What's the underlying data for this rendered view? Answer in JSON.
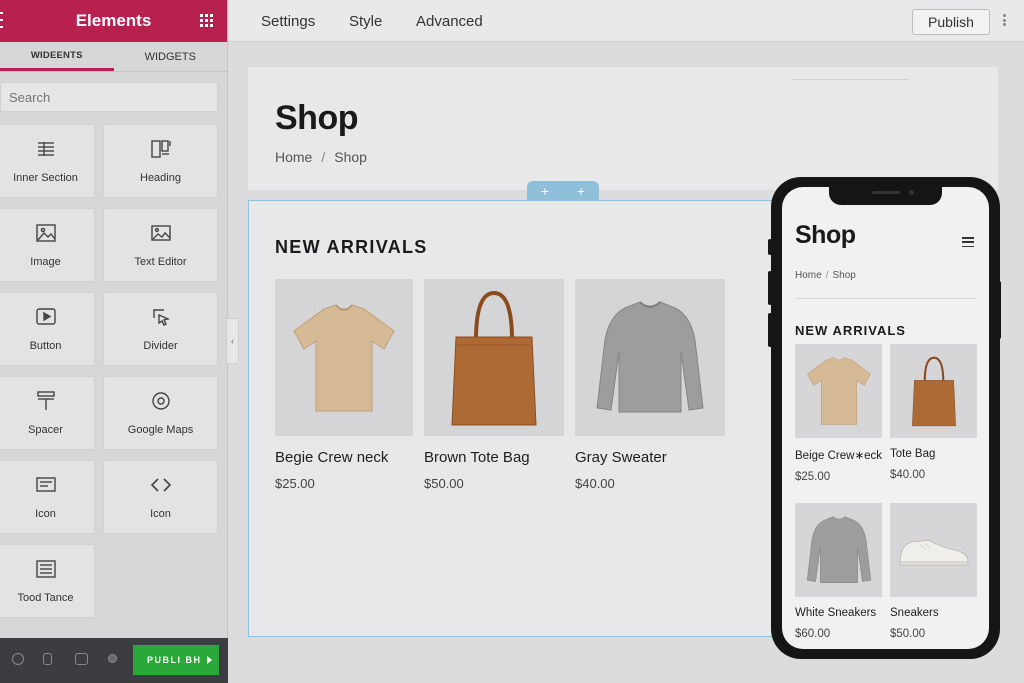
{
  "panel": {
    "title": "Elements",
    "tabs": [
      "WIDEENTS",
      "WIDGETS"
    ],
    "search_placeholder": "Search",
    "widgets": [
      {
        "label": "Inner Section",
        "icon": "inner-section-icon"
      },
      {
        "label": "Heading",
        "icon": "heading-icon"
      },
      {
        "label": "Image",
        "icon": "image-icon"
      },
      {
        "label": "Text Editor",
        "icon": "text-editor-icon"
      },
      {
        "label": "Button",
        "icon": "button-icon"
      },
      {
        "label": "Divider",
        "icon": "divider-icon"
      },
      {
        "label": "Spacer",
        "icon": "spacer-icon"
      },
      {
        "label": "Google Maps",
        "icon": "map-pin-icon"
      },
      {
        "label": "Icon",
        "icon": "icon-icon"
      },
      {
        "label": "Icon",
        "icon": "code-icon"
      },
      {
        "label": "Tood Tance",
        "icon": "text-block-icon"
      }
    ],
    "footer_publish": "PUBLI BH",
    "accent_color": "#b7204f",
    "publish_color": "#2aa83a"
  },
  "topbar": {
    "tabs": [
      "Settings",
      "Style",
      "Advanced"
    ],
    "publish_label": "Publish"
  },
  "page": {
    "title": "Shop",
    "breadcrumb": [
      "Home",
      "Shop"
    ],
    "breadcrumb_separator": "/",
    "section_heading": "NEW ARRIVALS",
    "products": [
      {
        "name": "Begie Crew neck",
        "price": "$25.00",
        "image": "beige-tshirt"
      },
      {
        "name": "Brown Tote Bag",
        "price": "$50.00",
        "image": "brown-tote-bag"
      },
      {
        "name": "Gray Sweater",
        "price": "$40.00",
        "image": "gray-sweater"
      }
    ]
  },
  "mobile": {
    "title": "Shop",
    "breadcrumb": [
      "Home",
      "Shop"
    ],
    "breadcrumb_separator": "/",
    "section_heading": "NEW ARRIVALS",
    "products": [
      {
        "name": "Beige Crew∗eck",
        "price": "$25.00",
        "image": "beige-tshirt"
      },
      {
        "name": "Tote Bag",
        "price": "$40.00",
        "image": "brown-tote-bag"
      },
      {
        "name": "White Sneakers",
        "price": "$60.00",
        "image": "gray-sweater"
      },
      {
        "name": "Sneakers",
        "price": "$50.00",
        "image": "white-sneakers"
      }
    ]
  }
}
